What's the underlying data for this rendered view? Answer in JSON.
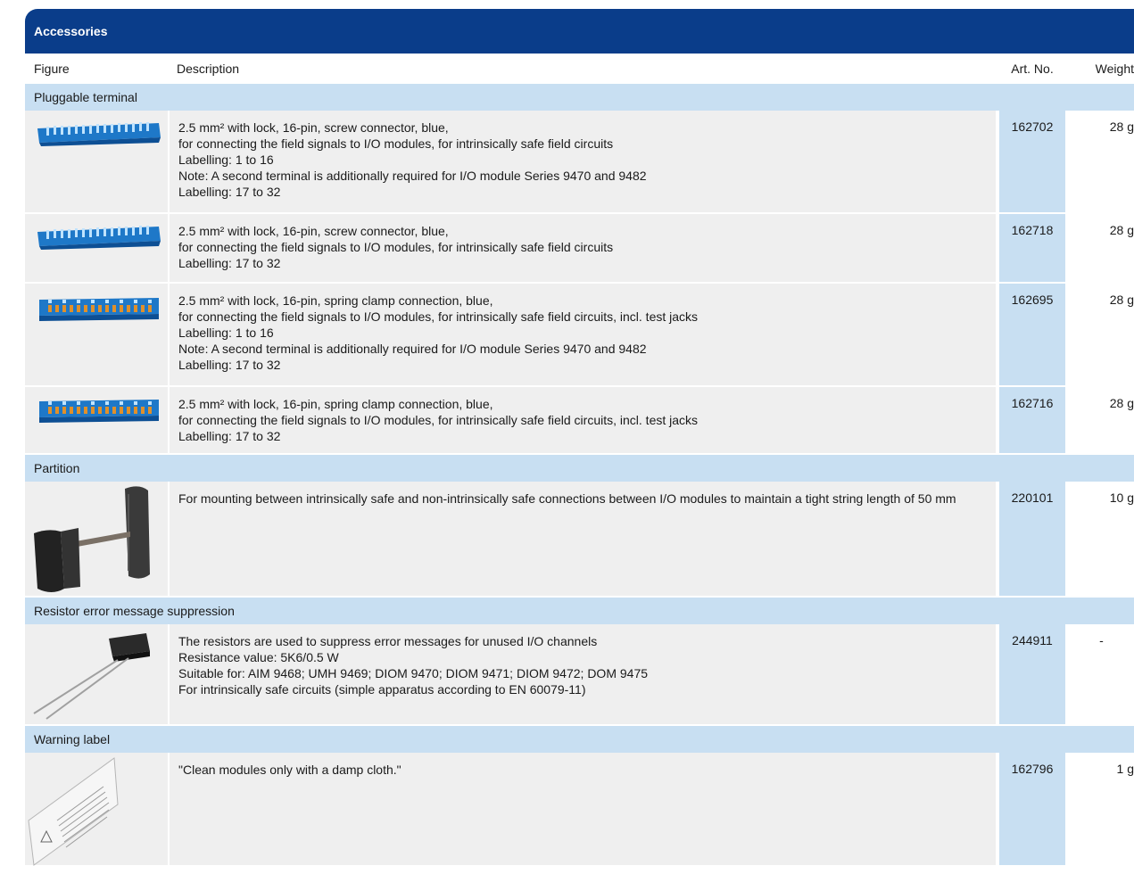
{
  "title": "Accessories",
  "headers": {
    "figure": "Figure",
    "description": "Description",
    "art_no": "Art. No.",
    "weight": "Weight"
  },
  "categories": [
    {
      "label": "Pluggable terminal"
    },
    {
      "label": "Partition"
    },
    {
      "label": "Resistor error message suppression"
    },
    {
      "label": "Warning label"
    }
  ],
  "rows": [
    {
      "icon": "blue-screw-terminal-icon",
      "lines": [
        "2.5 mm² with lock, 16-pin, screw connector, blue,",
        "for connecting the field signals to I/O modules, for intrinsically safe field circuits",
        "Labelling: 1 to 16",
        "Note: A second terminal is additionally required for I/O module Series 9470 and 9482",
        "Labelling: 17 to 32"
      ],
      "art_no": "162702",
      "weight": "28 g"
    },
    {
      "icon": "blue-screw-terminal-icon",
      "lines": [
        "2.5 mm² with lock, 16-pin, screw connector, blue,",
        "for connecting the field signals to I/O modules, for intrinsically safe field circuits",
        "Labelling: 17 to 32"
      ],
      "art_no": "162718",
      "weight": "28 g"
    },
    {
      "icon": "blue-spring-clamp-terminal-icon",
      "lines": [
        "2.5 mm² with lock, 16-pin, spring clamp connection, blue,",
        "for connecting the field signals to I/O modules, for intrinsically safe field circuits, incl. test jacks",
        "Labelling: 1 to 16",
        "Note: A second terminal is additionally required for I/O module Series 9470 and 9482",
        "Labelling: 17 to 32"
      ],
      "art_no": "162695",
      "weight": "28 g"
    },
    {
      "icon": "blue-spring-clamp-terminal-icon",
      "lines": [
        "2.5 mm² with lock, 16-pin, spring clamp connection, blue,",
        "for connecting the field signals to I/O modules, for intrinsically safe field circuits, incl. test jacks",
        "Labelling: 17 to 32"
      ],
      "art_no": "162716",
      "weight": "28 g"
    },
    {
      "icon": "partition-icon",
      "lines": [
        "For mounting between intrinsically safe and non-intrinsically safe connections between I/O modules to maintain a tight string length of 50 mm"
      ],
      "art_no": "220101",
      "weight": "10 g"
    },
    {
      "icon": "resistor-icon",
      "lines": [
        "The resistors are used to suppress error messages for unused I/O channels",
        "Resistance value: 5K6/0.5 W",
        "Suitable for: AIM 9468; UMH 9469; DIOM 9470; DIOM 9471; DIOM 9472; DOM 9475",
        "For intrinsically safe circuits (simple apparatus according to EN 60079-11)"
      ],
      "art_no": "244911",
      "weight": "-"
    },
    {
      "icon": "warning-label-icon",
      "lines": [
        "\"Clean modules only with a damp cloth.\""
      ],
      "art_no": "162796",
      "weight": "1 g"
    }
  ]
}
